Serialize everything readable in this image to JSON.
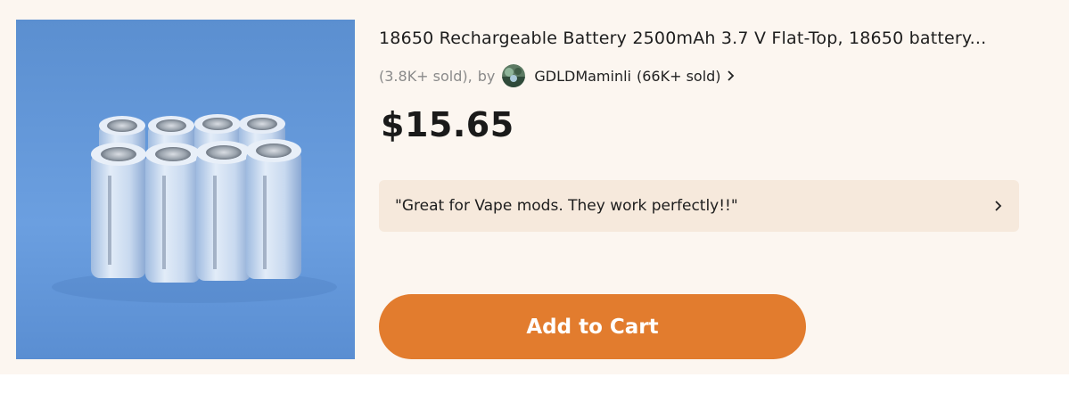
{
  "product": {
    "title": "18650 Rechargeable Battery 2500mAh 3.7 V Flat-Top, 18650 battery...",
    "sold_count": "(3.8K+ sold),",
    "by_label": "by",
    "store_name": "GDLDMaminli",
    "store_sold": "(66K+ sold)",
    "price": "$15.65",
    "review_quote": "\"Great for Vape mods. They work perfectly!!\"",
    "add_to_cart_label": "Add to Cart",
    "image_icon": "battery-product-photo",
    "store_avatar_icon": "store-avatar-icon",
    "chevron_icon": "chevron-right-icon"
  },
  "colors": {
    "card_background": "#fcf6f0",
    "review_background": "#f6e9dc",
    "cart_button": "#e27c2e",
    "price_text": "#1a1a1a",
    "muted_text": "#8a8a8a"
  }
}
